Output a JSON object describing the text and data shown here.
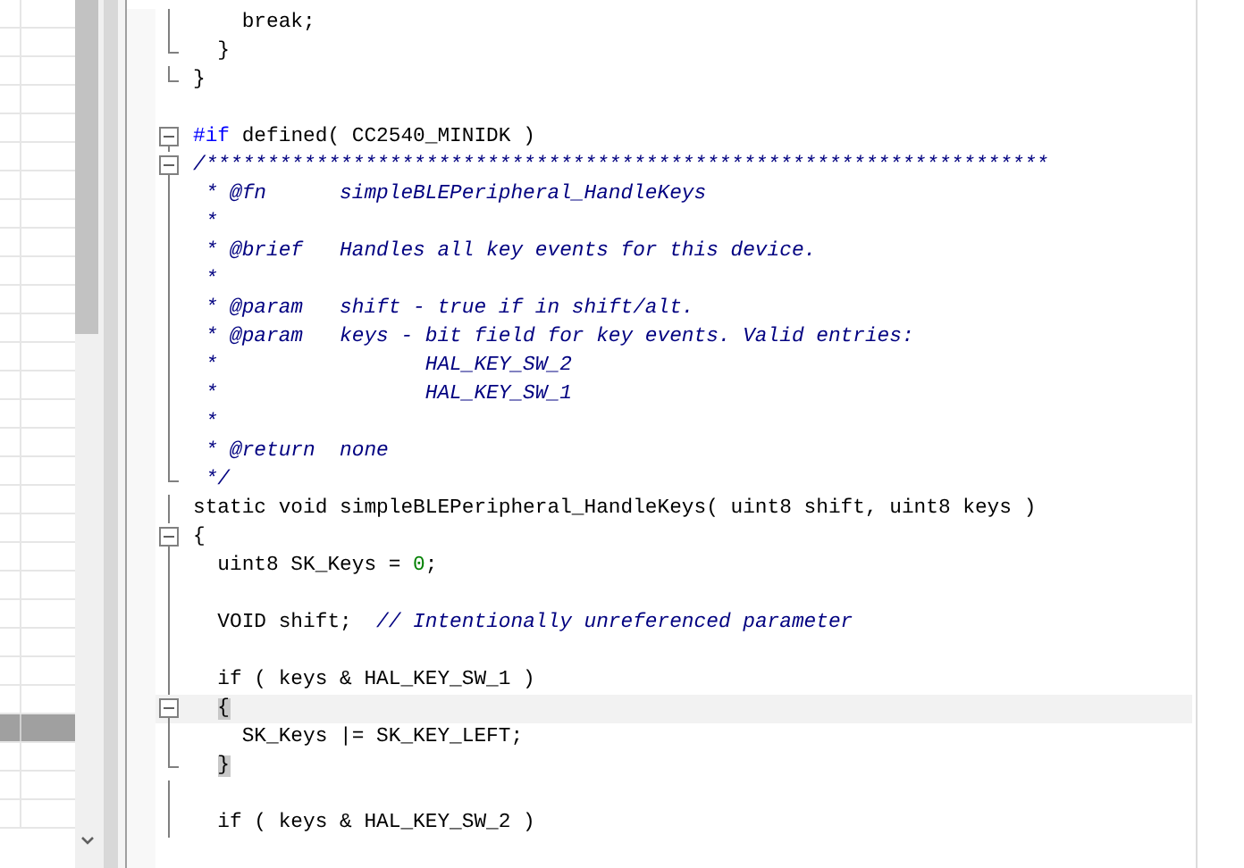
{
  "side_list": {
    "rows": [
      {
        "selected": false
      },
      {
        "selected": false
      },
      {
        "selected": false
      },
      {
        "selected": false
      },
      {
        "selected": false
      },
      {
        "selected": false
      },
      {
        "selected": false
      },
      {
        "selected": false
      },
      {
        "selected": false
      },
      {
        "selected": false
      },
      {
        "selected": false
      },
      {
        "selected": false
      },
      {
        "selected": false
      },
      {
        "selected": false
      },
      {
        "selected": false
      },
      {
        "selected": false
      },
      {
        "selected": false
      },
      {
        "selected": false
      },
      {
        "selected": false
      },
      {
        "selected": false
      },
      {
        "selected": false
      },
      {
        "selected": false
      },
      {
        "selected": false
      },
      {
        "selected": false
      },
      {
        "selected": false
      },
      {
        "selected": true
      },
      {
        "selected": false
      },
      {
        "selected": false
      },
      {
        "selected": false
      }
    ]
  },
  "editor": {
    "lines": [
      {
        "kind": "fold-line",
        "current": false,
        "tokens": [
          {
            "kind": "code",
            "text": "    break;"
          }
        ]
      },
      {
        "kind": "fold-end",
        "current": false,
        "tokens": [
          {
            "kind": "code",
            "text": "  }"
          }
        ]
      },
      {
        "kind": "fold-end",
        "current": false,
        "tokens": [
          {
            "kind": "code",
            "text": "}"
          }
        ]
      },
      {
        "kind": "plain"
      },
      {
        "kind": "fold-open",
        "current": false,
        "tokens": [
          {
            "kind": "preproc",
            "text": "#if"
          },
          {
            "kind": "code",
            "text": " defined( CC2540_MINIDK )"
          }
        ]
      },
      {
        "kind": "fold-open",
        "current": false,
        "tokens": [
          {
            "kind": "comment",
            "text": "/*********************************************************************"
          }
        ]
      },
      {
        "kind": "fold-line",
        "current": false,
        "tokens": [
          {
            "kind": "comment",
            "text": " * @fn      simpleBLEPeripheral_HandleKeys"
          }
        ]
      },
      {
        "kind": "fold-line",
        "current": false,
        "tokens": [
          {
            "kind": "comment",
            "text": " *"
          }
        ]
      },
      {
        "kind": "fold-line",
        "current": false,
        "tokens": [
          {
            "kind": "comment",
            "text": " * @brief   Handles all key events for this device."
          }
        ]
      },
      {
        "kind": "fold-line",
        "current": false,
        "tokens": [
          {
            "kind": "comment",
            "text": " *"
          }
        ]
      },
      {
        "kind": "fold-line",
        "current": false,
        "tokens": [
          {
            "kind": "comment",
            "text": " * @param   shift - true if in shift/alt."
          }
        ]
      },
      {
        "kind": "fold-line",
        "current": false,
        "tokens": [
          {
            "kind": "comment",
            "text": " * @param   keys - bit field for key events. Valid entries:"
          }
        ]
      },
      {
        "kind": "fold-line",
        "current": false,
        "tokens": [
          {
            "kind": "comment",
            "text": " *                 HAL_KEY_SW_2"
          }
        ]
      },
      {
        "kind": "fold-line",
        "current": false,
        "tokens": [
          {
            "kind": "comment",
            "text": " *                 HAL_KEY_SW_1"
          }
        ]
      },
      {
        "kind": "fold-line",
        "current": false,
        "tokens": [
          {
            "kind": "comment",
            "text": " *"
          }
        ]
      },
      {
        "kind": "fold-line",
        "current": false,
        "tokens": [
          {
            "kind": "comment",
            "text": " * @return  none"
          }
        ]
      },
      {
        "kind": "fold-end",
        "current": false,
        "tokens": [
          {
            "kind": "comment",
            "text": " */"
          }
        ]
      },
      {
        "kind": "fold-line",
        "current": false,
        "tokens": [
          {
            "kind": "code",
            "text": "static void simpleBLEPeripheral_HandleKeys( uint8 shift, uint8 keys )"
          }
        ]
      },
      {
        "kind": "fold-open",
        "current": false,
        "tokens": [
          {
            "kind": "code",
            "text": "{"
          }
        ]
      },
      {
        "kind": "fold-line",
        "current": false,
        "tokens": [
          {
            "kind": "code",
            "text": "  uint8 SK_Keys = "
          },
          {
            "kind": "number",
            "text": "0"
          },
          {
            "kind": "code",
            "text": ";"
          }
        ]
      },
      {
        "kind": "fold-line",
        "current": false
      },
      {
        "kind": "fold-line",
        "current": false,
        "tokens": [
          {
            "kind": "code",
            "text": "  VOID shift;  "
          },
          {
            "kind": "comment",
            "text": "// Intentionally unreferenced parameter"
          }
        ]
      },
      {
        "kind": "fold-line",
        "current": false
      },
      {
        "kind": "fold-line",
        "current": false,
        "tokens": [
          {
            "kind": "code",
            "text": "  if ( keys & HAL_KEY_SW_1 )"
          }
        ]
      },
      {
        "kind": "fold-open",
        "current": true,
        "tokens": [
          {
            "kind": "brace",
            "text": "  {"
          }
        ]
      },
      {
        "kind": "fold-line",
        "current": false,
        "tokens": [
          {
            "kind": "code",
            "text": "    SK_Keys |= SK_KEY_LEFT;"
          }
        ]
      },
      {
        "kind": "fold-end",
        "current": false,
        "tokens": [
          {
            "kind": "brace",
            "text": "  }"
          }
        ]
      },
      {
        "kind": "fold-line",
        "current": false
      },
      {
        "kind": "fold-line",
        "current": false,
        "tokens": [
          {
            "kind": "code",
            "text": "  if ( keys & HAL_KEY_SW_2 )"
          }
        ]
      }
    ]
  }
}
